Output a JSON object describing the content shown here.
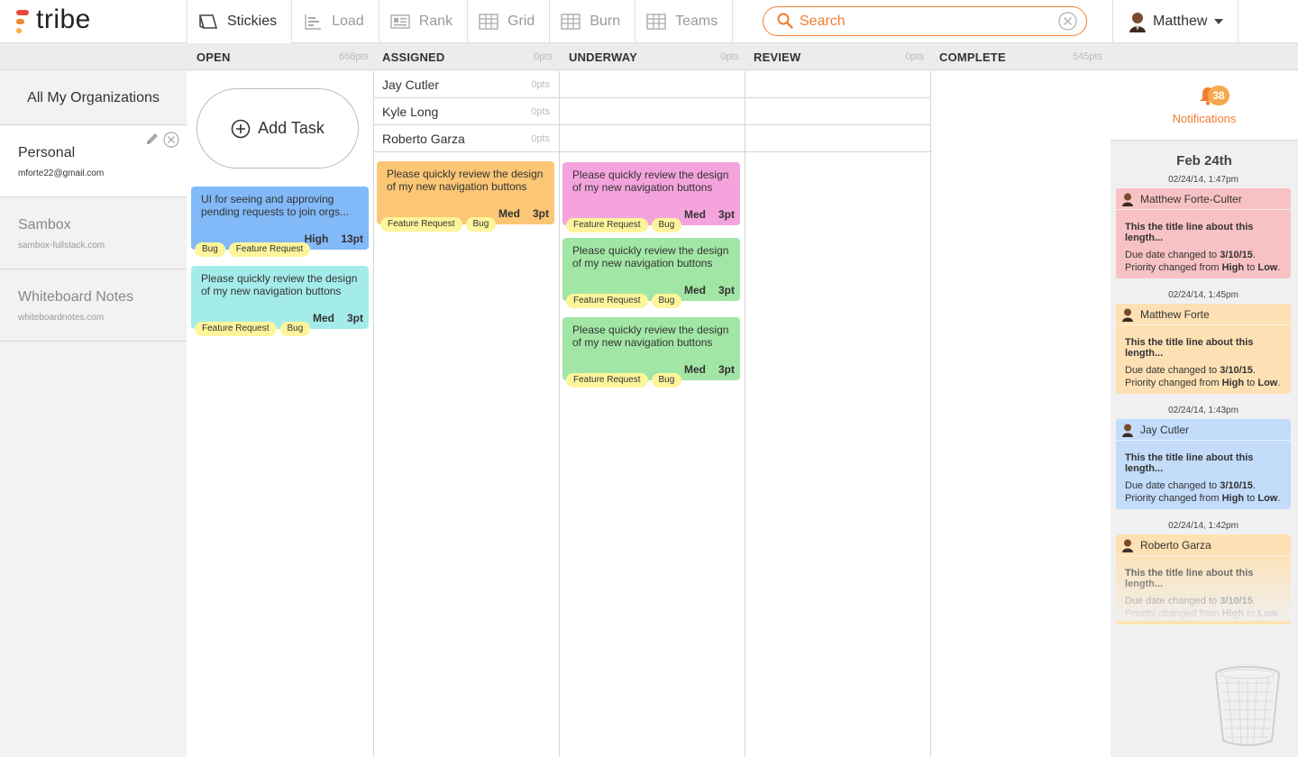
{
  "app": {
    "logo_text": "tribe"
  },
  "nav": {
    "tabs": [
      {
        "label": "Stickies",
        "icon": "stickies-icon",
        "active": true
      },
      {
        "label": "Load",
        "icon": "load-icon",
        "active": false
      },
      {
        "label": "Rank",
        "icon": "rank-icon",
        "active": false
      },
      {
        "label": "Grid",
        "icon": "grid-icon",
        "active": false
      },
      {
        "label": "Burn",
        "icon": "burn-icon",
        "active": false
      },
      {
        "label": "Teams",
        "icon": "teams-icon",
        "active": false
      }
    ]
  },
  "search": {
    "placeholder": "Search"
  },
  "user": {
    "name": "Matthew"
  },
  "columns": [
    {
      "name": "OPEN",
      "pts": "668pts"
    },
    {
      "name": "ASSIGNED",
      "pts": "0pts"
    },
    {
      "name": "UNDERWAY",
      "pts": "0pts"
    },
    {
      "name": "REVIEW",
      "pts": "0pts"
    },
    {
      "name": "COMPLETE",
      "pts": "545pts"
    }
  ],
  "sidebar": {
    "all_label": "All My Organizations",
    "orgs": [
      {
        "name": "Personal",
        "email": "mforte22@gmail.com",
        "active": true
      },
      {
        "name": "Sambox",
        "email": "sambox-fullstack.com",
        "active": false
      },
      {
        "name": "Whiteboard Notes",
        "email": "whiteboardnotes.com",
        "active": false
      }
    ]
  },
  "add_task_label": "Add Task",
  "assignees": [
    {
      "name": "Jay Cutler",
      "pts": "0pts"
    },
    {
      "name": "Kyle Long",
      "pts": "0pts"
    },
    {
      "name": "Roberto Garza",
      "pts": "0pts"
    }
  ],
  "cards": {
    "open": [
      {
        "title": "UI for seeing and approving pending requests to join orgs...",
        "priority": "High",
        "points": "13pt",
        "color": "#82b9f8",
        "tags": [
          "Bug",
          "Feature Request"
        ]
      },
      {
        "title": "Please quickly review the design of my new navigation buttons",
        "priority": "Med",
        "points": "3pt",
        "color": "#a4ecea",
        "tags": [
          "Feature Request",
          "Bug"
        ]
      }
    ],
    "assigned": [
      {
        "title": "Please quickly review the design of my new navigation buttons",
        "priority": "Med",
        "points": "3pt",
        "color": "#fbc675",
        "tags": [
          "Feature Request",
          "Bug"
        ]
      }
    ],
    "underway": [
      {
        "title": "Please quickly review the design of my new navigation buttons",
        "priority": "Med",
        "points": "3pt",
        "color": "#f4a3dd",
        "tags": [
          "Feature Request",
          "Bug"
        ]
      },
      {
        "title": "Please quickly review the design of my new navigation buttons",
        "priority": "Med",
        "points": "3pt",
        "color": "#a2e6a5",
        "tags": [
          "Feature Request",
          "Bug"
        ]
      },
      {
        "title": "Please quickly review the design of my new navigation buttons",
        "priority": "Med",
        "points": "3pt",
        "color": "#a2e6a5",
        "tags": [
          "Feature Request",
          "Bug"
        ]
      }
    ]
  },
  "notifications": {
    "count": "38",
    "label": "Notifications",
    "date": "Feb 24th",
    "items": [
      {
        "time": "02/24/14, 1:47pm",
        "who": "Matthew Forte-Culter",
        "title": "This the title line about this length...",
        "line1_pre": "Due date changed to ",
        "line1_val": "3/10/15",
        "line1_post": ".",
        "line2_pre": "Priority changed from ",
        "line2_a": "High",
        "line2_mid": " to ",
        "line2_b": "Low",
        "line2_post": ".",
        "color": "#f8c2c4"
      },
      {
        "time": "02/24/14, 1:45pm",
        "who": "Matthew Forte",
        "title": "This the title line about this length...",
        "line1_pre": "Due date changed to ",
        "line1_val": "3/10/15",
        "line1_post": ".",
        "line2_pre": "Priority changed from ",
        "line2_a": "High",
        "line2_mid": " to ",
        "line2_b": "Low",
        "line2_post": ".",
        "color": "#fde1b4"
      },
      {
        "time": "02/24/14, 1:43pm",
        "who": "Jay Cutler",
        "title": "This the title line about this length...",
        "line1_pre": "Due date changed to ",
        "line1_val": "3/10/15",
        "line1_post": ".",
        "line2_pre": "Priority changed from ",
        "line2_a": "High",
        "line2_mid": " to ",
        "line2_b": "Low",
        "line2_post": ".",
        "color": "#c2dcfa"
      },
      {
        "time": "02/24/14, 1:42pm",
        "who": "Roberto Garza",
        "title": "This the title line about this length...",
        "line1_pre": "Due date changed to ",
        "line1_val": "3/10/15",
        "line1_post": ".",
        "line2_pre": "Priority changed from ",
        "line2_a": "High",
        "line2_mid": " to ",
        "line2_b": "Low",
        "line2_post": ".",
        "color": "#fde1b4"
      }
    ]
  },
  "colors": {
    "accent": "#f07d32",
    "tag": "#fdf59b"
  }
}
